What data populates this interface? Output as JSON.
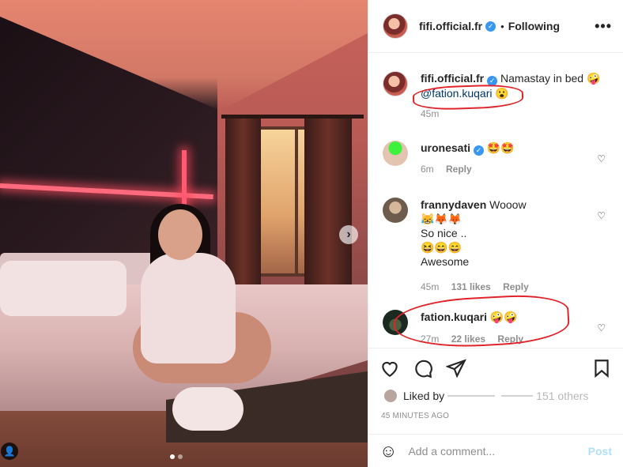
{
  "post": {
    "author": "fifi.official.fr",
    "follow_state": "Following",
    "more_icon": "more-horizontal-icon",
    "caption_text": "Namastay in bed 🤪",
    "caption_mention": "@fation.kuqari 😮",
    "caption_age": "45m",
    "carousel_next_icon": "chevron-right-icon",
    "carousel": {
      "total": 2,
      "current": 1
    }
  },
  "comments": [
    {
      "user": "uronesati",
      "verified": true,
      "text": "🤩🤩",
      "age": "6m",
      "likes": "",
      "reply": "Reply"
    },
    {
      "user": "frannydaven",
      "verified": false,
      "text": "Wooow",
      "lines": [
        "😹🦊🦊",
        "So nice ..",
        "😆😄😄",
        "Awesome"
      ],
      "age": "45m",
      "likes": "131 likes",
      "reply": "Reply"
    },
    {
      "user": "fation.kuqari",
      "verified": false,
      "text": "🤪🤪",
      "age": "27m",
      "likes": "22 likes",
      "reply": "Reply"
    }
  ],
  "actions": {
    "like_icon": "heart-icon",
    "comment_icon": "comment-icon",
    "share_icon": "share-icon",
    "save_icon": "bookmark-icon"
  },
  "liked_by": {
    "prefix": "Liked by",
    "suffix": "151 others"
  },
  "timestamp": "45 MINUTES AGO",
  "add_comment": {
    "placeholder": "Add a comment...",
    "post_label": "Post",
    "emoji_icon": "smiley-icon"
  },
  "colors": {
    "accent": "#3897f0",
    "annotation_red": "#e0242b",
    "post_disabled": "#b2dffc",
    "mention": "#00376b"
  }
}
